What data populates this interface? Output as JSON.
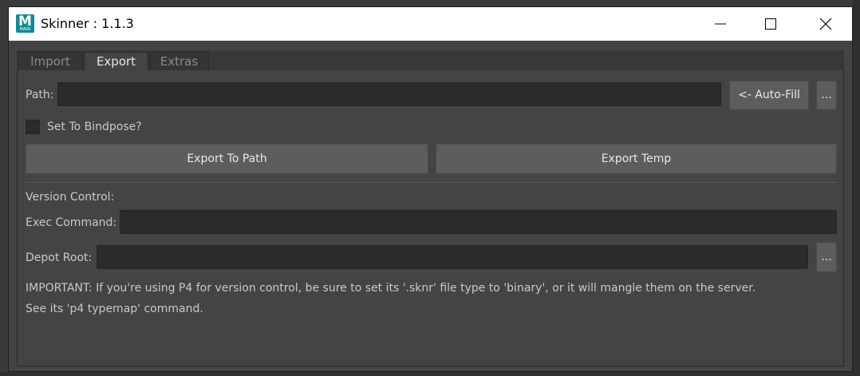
{
  "window": {
    "title": "Skinner : 1.1.3",
    "app_icon_letter": "M",
    "app_icon_sub": "MAYA"
  },
  "tabs": [
    {
      "label": "Import",
      "active": false
    },
    {
      "label": "Export",
      "active": true
    },
    {
      "label": "Extras",
      "active": false
    }
  ],
  "export": {
    "path_label": "Path:",
    "path_value": "",
    "autofill_label": "<- Auto-Fill",
    "browse_label": "...",
    "bindpose_label": "Set To Bindpose?",
    "bindpose_checked": false,
    "export_to_path_label": "Export To Path",
    "export_temp_label": "Export Temp"
  },
  "version_control": {
    "section_label": "Version Control:",
    "exec_label": "Exec Command:",
    "exec_value": "",
    "depot_label": "Depot Root:",
    "depot_value": "",
    "depot_browse_label": "...",
    "note_line1": "IMPORTANT: If you're using P4 for version control, be sure to set its '.sknr' file type to 'binary', or it will mangle them on the server.",
    "note_line2": "See its 'p4 typemap' command."
  },
  "colors": {
    "panel": "#444444",
    "field": "#2b2b2b",
    "button": "#5d5d5d",
    "maya_teal": "#0f8c95"
  },
  "icons": [
    "maya-app-icon",
    "minimize-icon",
    "maximize-icon",
    "close-icon"
  ]
}
